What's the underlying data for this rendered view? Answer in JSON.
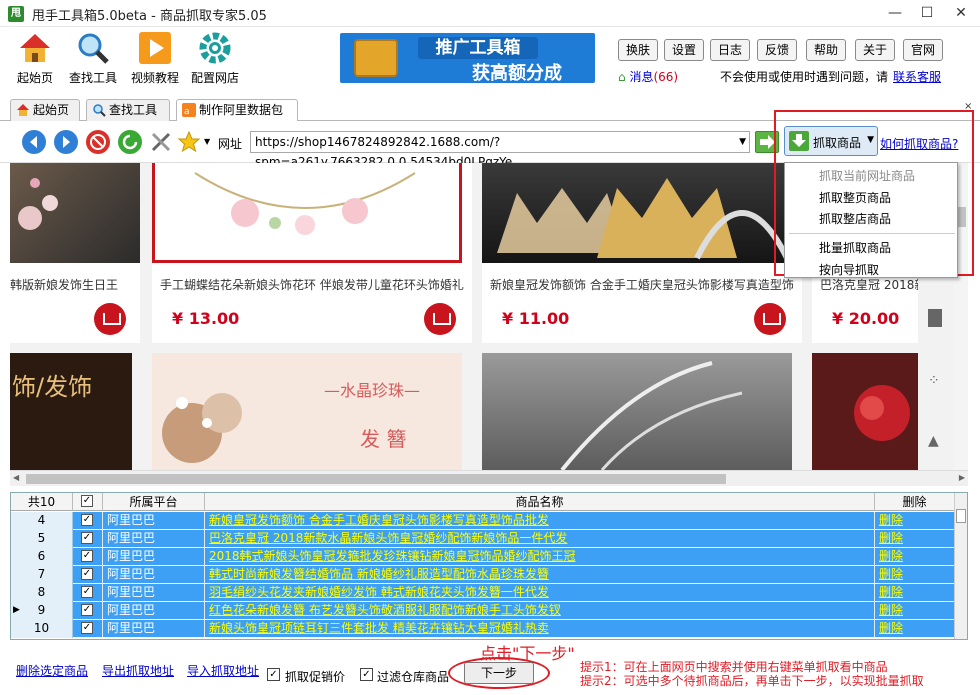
{
  "window": {
    "title": "甩手工具箱5.0beta - 商品抓取专家5.05",
    "logo_text": "甩"
  },
  "toolbar": {
    "tools": [
      {
        "label": "起始页",
        "icon": "home-icon"
      },
      {
        "label": "查找工具",
        "icon": "magnifier-icon"
      },
      {
        "label": "视频教程",
        "icon": "video-play-icon"
      },
      {
        "label": "配置网店",
        "icon": "gear-icon"
      }
    ],
    "banner": {
      "line1": "推广工具箱",
      "line2": "获高额分成"
    },
    "buttons": [
      "换肤",
      "设置",
      "日志",
      "反馈",
      "帮助",
      "关于",
      "官网"
    ],
    "message_label": "消息",
    "message_count": "(66)",
    "help_text": "不会使用或使用时遇到问题，请",
    "help_link": "联系客服"
  },
  "tabs": [
    {
      "label": "起始页",
      "icon": "home-icon"
    },
    {
      "label": "查找工具",
      "icon": "magnifier-icon"
    },
    {
      "label": "制作阿里数据包",
      "icon": "alibaba-icon"
    }
  ],
  "navbar": {
    "url_label": "网址",
    "url": "https://shop1467824892842.1688.com/?spm=a261y.7663282.0.0.54534bd0LPqzYe",
    "grab_button": "抓取商品",
    "how_link": "如何抓取商品?"
  },
  "grab_menu": {
    "items": [
      {
        "label": "抓取当前网址商品",
        "disabled": true
      },
      {
        "label": "抓取整页商品",
        "disabled": false
      },
      {
        "label": "抓取整店商品",
        "disabled": false
      },
      {
        "label": "批量抓取商品",
        "disabled": false
      },
      {
        "label": "按向导抓取",
        "disabled": false
      }
    ]
  },
  "products": [
    {
      "title": "韩版新娘发饰生日王",
      "price": ""
    },
    {
      "title": "手工蝴蝶结花朵新娘头饰花环 伴娘发带儿童花环头饰婚礼",
      "price": "¥ 13.00"
    },
    {
      "title": "新娘皇冠发饰额饰 合金手工婚庆皇冠头饰影楼写真造型饰",
      "price": "¥ 11.00"
    },
    {
      "title": "巴洛克皇冠 2018新",
      "price": "¥ 20.00"
    }
  ],
  "products_row2": [
    {
      "text": "饰/发饰"
    },
    {
      "text1": "—水晶珍珠—",
      "text2": "发 簪"
    }
  ],
  "grid": {
    "count_header": "共10",
    "platform_header": "所属平台",
    "name_header": "商品名称",
    "delete_header": "删除",
    "rows": [
      {
        "num": "4",
        "platform": "阿里巴巴",
        "name": "新娘皇冠发饰额饰 合金手工婚庆皇冠头饰影楼写真造型饰品批发",
        "del": "删除"
      },
      {
        "num": "5",
        "platform": "阿里巴巴",
        "name": "巴洛克皇冠 2018新款水晶新娘头饰皇冠婚纱配饰新娘饰品一件代发",
        "del": "删除"
      },
      {
        "num": "6",
        "platform": "阿里巴巴",
        "name": "2018韩式新娘头饰皇冠发箍批发珍珠镶钻新娘皇冠饰品婚纱配饰王冠",
        "del": "删除"
      },
      {
        "num": "7",
        "platform": "阿里巴巴",
        "name": "韩式时尚新娘发簪结婚饰品 新娘婚纱礼服造型配饰水晶珍珠发簪",
        "del": "删除"
      },
      {
        "num": "8",
        "platform": "阿里巴巴",
        "name": "羽毛绢纱头花发夹新娘婚纱发饰 韩式新娘花夹头饰发簪一件代发",
        "del": "删除"
      },
      {
        "num": "9",
        "platform": "阿里巴巴",
        "name": "红色花朵新娘发簪 布艺发簪头饰敬酒服礼服配饰新娘手工头饰发钗",
        "del": "删除"
      },
      {
        "num": "10",
        "platform": "阿里巴巴",
        "name": "新娘头饰皇冠项链耳钉三件套批发 精美花卉镶钻大皇冠婚礼热卖",
        "del": "删除"
      }
    ]
  },
  "bottom": {
    "delete_selected": "删除选定商品",
    "export_link": "导出抓取地址",
    "import_link": "导入抓取地址",
    "check_promo": "抓取促销价",
    "check_filter": "过滤仓库商品",
    "next_button": "下一步",
    "annotation": "点击\"下一步\"",
    "tip1": "提示1：可在上面网页中搜索并使用右键菜单抓取看中商品",
    "tip2": "提示2：可选中多个待抓商品后，再单击下一步，以实现批量抓取"
  }
}
